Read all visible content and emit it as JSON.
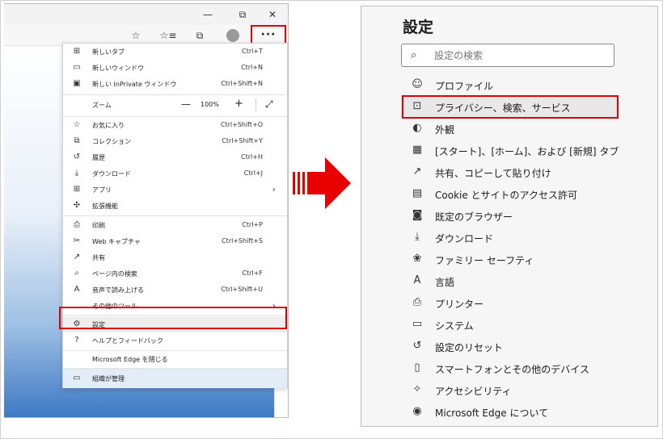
{
  "browser": {
    "window_controls": {
      "minimize": "—",
      "restore": "⧉",
      "close": "✕"
    },
    "toolbar_icons": [
      "favorites-add-icon",
      "favorites-icon",
      "collections-icon",
      "profile-icon"
    ],
    "more_button_label": "···"
  },
  "menu": {
    "items": [
      {
        "label": "新しいタブ",
        "shortcut": "Ctrl+T",
        "icon": "new-tab-icon",
        "glyph": "⊞"
      },
      {
        "label": "新しいウィンドウ",
        "shortcut": "Ctrl+N",
        "icon": "new-window-icon",
        "glyph": "▭"
      },
      {
        "label": "新しい InPrivate ウィンドウ",
        "shortcut": "Ctrl+Shift+N",
        "icon": "inprivate-icon",
        "glyph": "▣"
      },
      {
        "label": "お気に入り",
        "shortcut": "Ctrl+Shift+O",
        "icon": "favorites-icon",
        "glyph": "☆"
      },
      {
        "label": "コレクション",
        "shortcut": "Ctrl+Shift+Y",
        "icon": "collections-icon",
        "glyph": "⧉"
      },
      {
        "label": "履歴",
        "shortcut": "Ctrl+H",
        "icon": "history-icon",
        "glyph": "↺"
      },
      {
        "label": "ダウンロード",
        "shortcut": "Ctrl+J",
        "icon": "download-icon",
        "glyph": "⤓"
      },
      {
        "label": "アプリ",
        "shortcut": "",
        "icon": "apps-icon",
        "glyph": "⊞"
      },
      {
        "label": "拡張機能",
        "shortcut": "",
        "icon": "extensions-icon",
        "glyph": "✣"
      },
      {
        "label": "印刷",
        "shortcut": "Ctrl+P",
        "icon": "print-icon",
        "glyph": "⎙"
      },
      {
        "label": "Web キャプチャ",
        "shortcut": "Ctrl+Shift+S",
        "icon": "web-capture-icon",
        "glyph": "✂"
      },
      {
        "label": "共有",
        "shortcut": "",
        "icon": "share-icon",
        "glyph": "↗"
      },
      {
        "label": "ページ内の検索",
        "shortcut": "Ctrl+F",
        "icon": "find-icon",
        "glyph": "⌕"
      },
      {
        "label": "音声で読み上げる",
        "shortcut": "Ctrl+Shift+U",
        "icon": "read-aloud-icon",
        "glyph": "A"
      },
      {
        "label": "その他のツール",
        "shortcut": "",
        "icon": "",
        "glyph": ""
      },
      {
        "label": "設定",
        "shortcut": "",
        "icon": "settings-gear-icon",
        "glyph": "⚙"
      },
      {
        "label": "ヘルプとフィードバック",
        "shortcut": "",
        "icon": "help-icon",
        "glyph": "?"
      },
      {
        "label": "Microsoft Edge を閉じる",
        "shortcut": "",
        "icon": "",
        "glyph": ""
      },
      {
        "label": "組織が管理",
        "shortcut": "",
        "icon": "managed-icon",
        "glyph": "▭"
      }
    ],
    "zoom": {
      "label": "ズーム",
      "minus": "—",
      "value": "100%",
      "plus": "+",
      "fullscreen": "⤢"
    },
    "submenu_arrow": "›"
  },
  "settings": {
    "title": "設定",
    "search_placeholder": "設定の検索",
    "search_icon_glyph": "⌕",
    "nav": [
      {
        "label": "プロファイル",
        "icon": "profile-icon",
        "glyph": "☺"
      },
      {
        "label": "プライバシー、検索、サービス",
        "icon": "lock-icon",
        "glyph": "🔒"
      },
      {
        "label": "外観",
        "icon": "palette-icon",
        "glyph": "◐"
      },
      {
        "label": "[スタート]、[ホーム]、および [新規] タブ",
        "icon": "home-tab-icon",
        "glyph": "▦"
      },
      {
        "label": "共有、コピーして貼り付け",
        "icon": "share-icon",
        "glyph": "↗"
      },
      {
        "label": "Cookie とサイトのアクセス許可",
        "icon": "cookie-icon",
        "glyph": "▤"
      },
      {
        "label": "既定のブラウザー",
        "icon": "default-browser-icon",
        "glyph": "◙"
      },
      {
        "label": "ダウンロード",
        "icon": "download-icon",
        "glyph": "⤓"
      },
      {
        "label": "ファミリー セーフティ",
        "icon": "family-icon",
        "glyph": "❀"
      },
      {
        "label": "言語",
        "icon": "language-icon",
        "glyph": "A"
      },
      {
        "label": "プリンター",
        "icon": "printer-icon",
        "glyph": "⎙"
      },
      {
        "label": "システム",
        "icon": "system-icon",
        "glyph": "▭"
      },
      {
        "label": "設定のリセット",
        "icon": "reset-icon",
        "glyph": "↺"
      },
      {
        "label": "スマートフォンとその他のデバイス",
        "icon": "phone-icon",
        "glyph": "▯"
      },
      {
        "label": "アクセシビリティ",
        "icon": "accessibility-icon",
        "glyph": "✧"
      },
      {
        "label": "Microsoft Edge について",
        "icon": "edge-logo-icon",
        "glyph": "◉"
      }
    ]
  },
  "colors": {
    "highlight_red": "#e00000",
    "arrow_red": "#e60000"
  }
}
